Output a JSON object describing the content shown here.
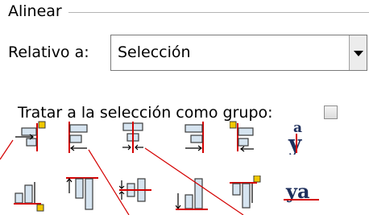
{
  "panel": {
    "title": "Alinear"
  },
  "relativo": {
    "label": "Relativo a:",
    "selected": "Selección"
  },
  "group": {
    "label": "Tratar a la selección como grupo:",
    "checked": false
  },
  "icons": {
    "row1": [
      "align-right-edge-to-left-anchor-icon",
      "align-left-edges-icon",
      "center-on-vertical-axis-icon",
      "align-right-edges-icon",
      "align-left-edge-to-right-anchor-icon",
      "align-text-baseline-horizontal-icon"
    ],
    "row2": [
      "align-bottom-edge-to-top-anchor-icon",
      "align-top-edges-icon",
      "center-on-horizontal-axis-icon",
      "align-bottom-edges-icon",
      "align-top-edge-to-bottom-anchor-icon"
    ]
  },
  "baseline_glyphs": {
    "vertical_top": "a",
    "vertical_bottom": "y",
    "horizontal": "ya"
  },
  "colors": {
    "accent_red": "#d40000",
    "anchor_yellow": "#f0c800",
    "box_fill": "#d6e4f0",
    "box_stroke": "#3b3b3b"
  }
}
